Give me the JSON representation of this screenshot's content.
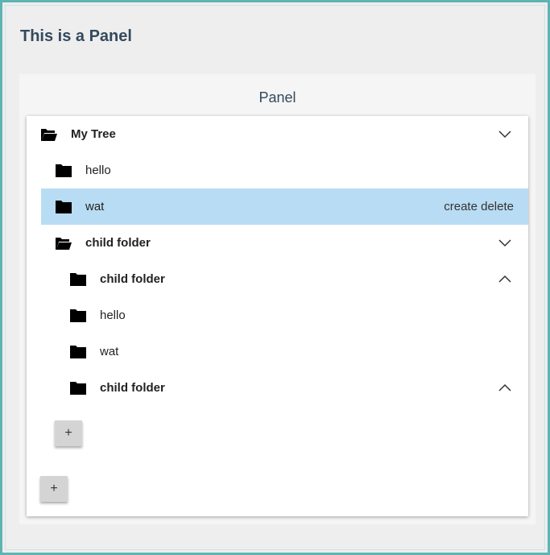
{
  "page": {
    "title": "This is a Panel"
  },
  "panel": {
    "header": "Panel"
  },
  "tree": {
    "root": {
      "label": "My Tree",
      "icon": "folder-open-icon",
      "expanded": true
    },
    "rows": [
      {
        "label": "hello",
        "icon": "folder-icon",
        "bold": false
      },
      {
        "label": "wat",
        "icon": "folder-icon",
        "bold": false,
        "selected": true,
        "actions": {
          "create": "create",
          "delete": "delete"
        }
      },
      {
        "label": "child folder",
        "icon": "folder-open-icon",
        "bold": true,
        "expanded": true
      },
      {
        "label": "child folder",
        "icon": "folder-icon",
        "bold": true,
        "expanded": false
      },
      {
        "label": "hello",
        "icon": "folder-icon",
        "bold": false
      },
      {
        "label": "wat",
        "icon": "folder-icon",
        "bold": false
      },
      {
        "label": "child folder",
        "icon": "folder-icon",
        "bold": true,
        "expanded": false
      }
    ],
    "add_child_label": "+",
    "add_root_label": "+"
  },
  "colors": {
    "frame_border": "#5fb3b3",
    "selected_row": "#b8dcf3",
    "title_text": "#34495e"
  }
}
